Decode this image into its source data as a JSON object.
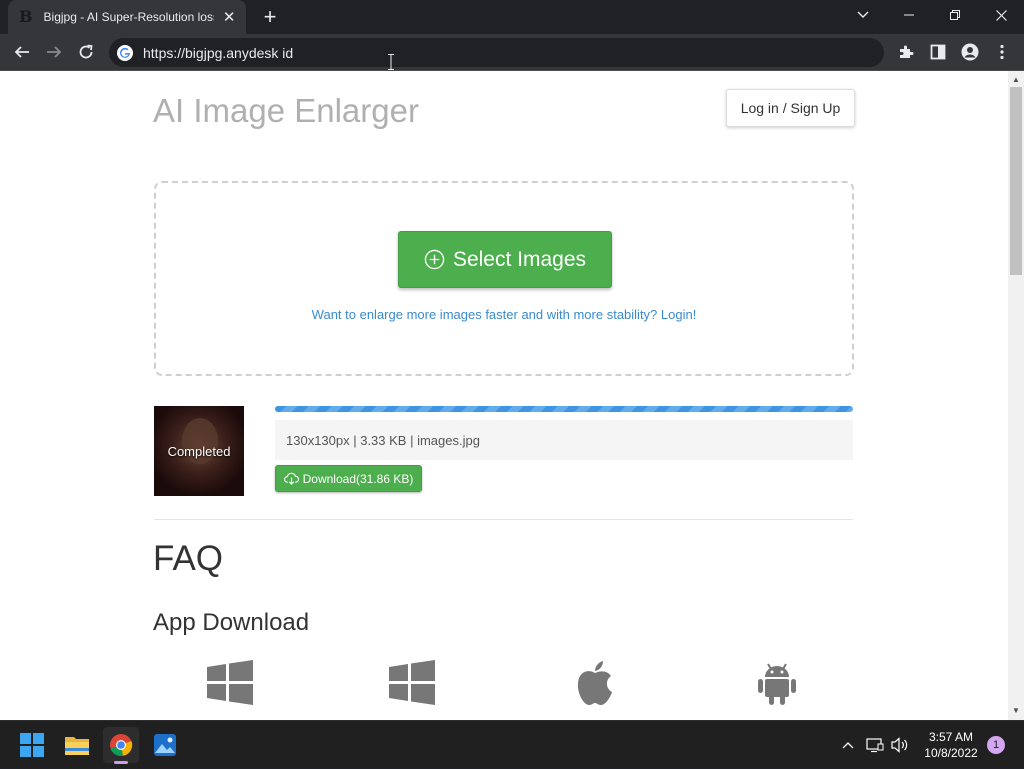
{
  "browser": {
    "tab": {
      "favicon": "B",
      "title": "Bigjpg - AI Super-Resolution lossless image enlarging / upscaling tool",
      "close_icon": "close-icon"
    },
    "new_tab_icon": "plus-icon",
    "url": "https://bigjpg.anydesk id",
    "toolbar_icons": [
      "back-arrow-icon",
      "forward-arrow-icon",
      "reload-icon",
      "extensions-icon",
      "side-panel-icon",
      "profile-icon",
      "menu-kebab-icon"
    ]
  },
  "page": {
    "title": "AI Image Enlarger",
    "login_label": "Log in / Sign Up",
    "select_button_label": "Select Images",
    "dropzone_hint": "Want to enlarge more images faster and with more stability? Login!",
    "upload": {
      "thumb_status": "Completed",
      "progress_fraction": 1.0,
      "file_info": "130x130px | 3.33 KB | images.jpg",
      "download_label": "Download(31.86 KB)"
    },
    "faq_heading": "FAQ",
    "app_download_heading": "App Download",
    "app_icons": [
      "windows-icon",
      "windows-icon",
      "apple-icon",
      "android-icon"
    ]
  },
  "taskbar": {
    "clock_time": "3:57 AM",
    "clock_date": "10/8/2022",
    "notification_count": "1"
  },
  "colors": {
    "accent_green": "#4cae4c",
    "link_blue": "#3a8bcd",
    "progress_blue": "#3d95e3"
  }
}
